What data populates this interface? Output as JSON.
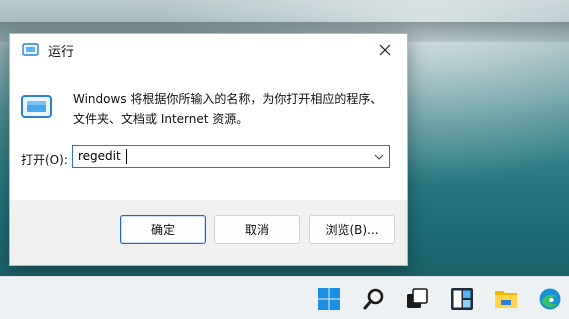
{
  "dialog": {
    "title": "运行",
    "description_line1": "Windows 将根据你所输入的名称，为你打开相应的程序、",
    "description_line2": "文件夹、文档或 Internet 资源。",
    "open_label": "打开(O):",
    "open_value": "regedit",
    "buttons": {
      "ok": "确定",
      "cancel": "取消",
      "browse": "浏览(B)..."
    }
  },
  "taskbar": {
    "icons": [
      "windows-start-icon",
      "search-icon",
      "task-view-icon",
      "widgets-icon",
      "file-explorer-icon",
      "edge-icon"
    ]
  },
  "colors": {
    "accent": "#2f6fd1",
    "dialog_bg": "#f0f0f0",
    "taskbar_bg": "#eef1f4"
  }
}
